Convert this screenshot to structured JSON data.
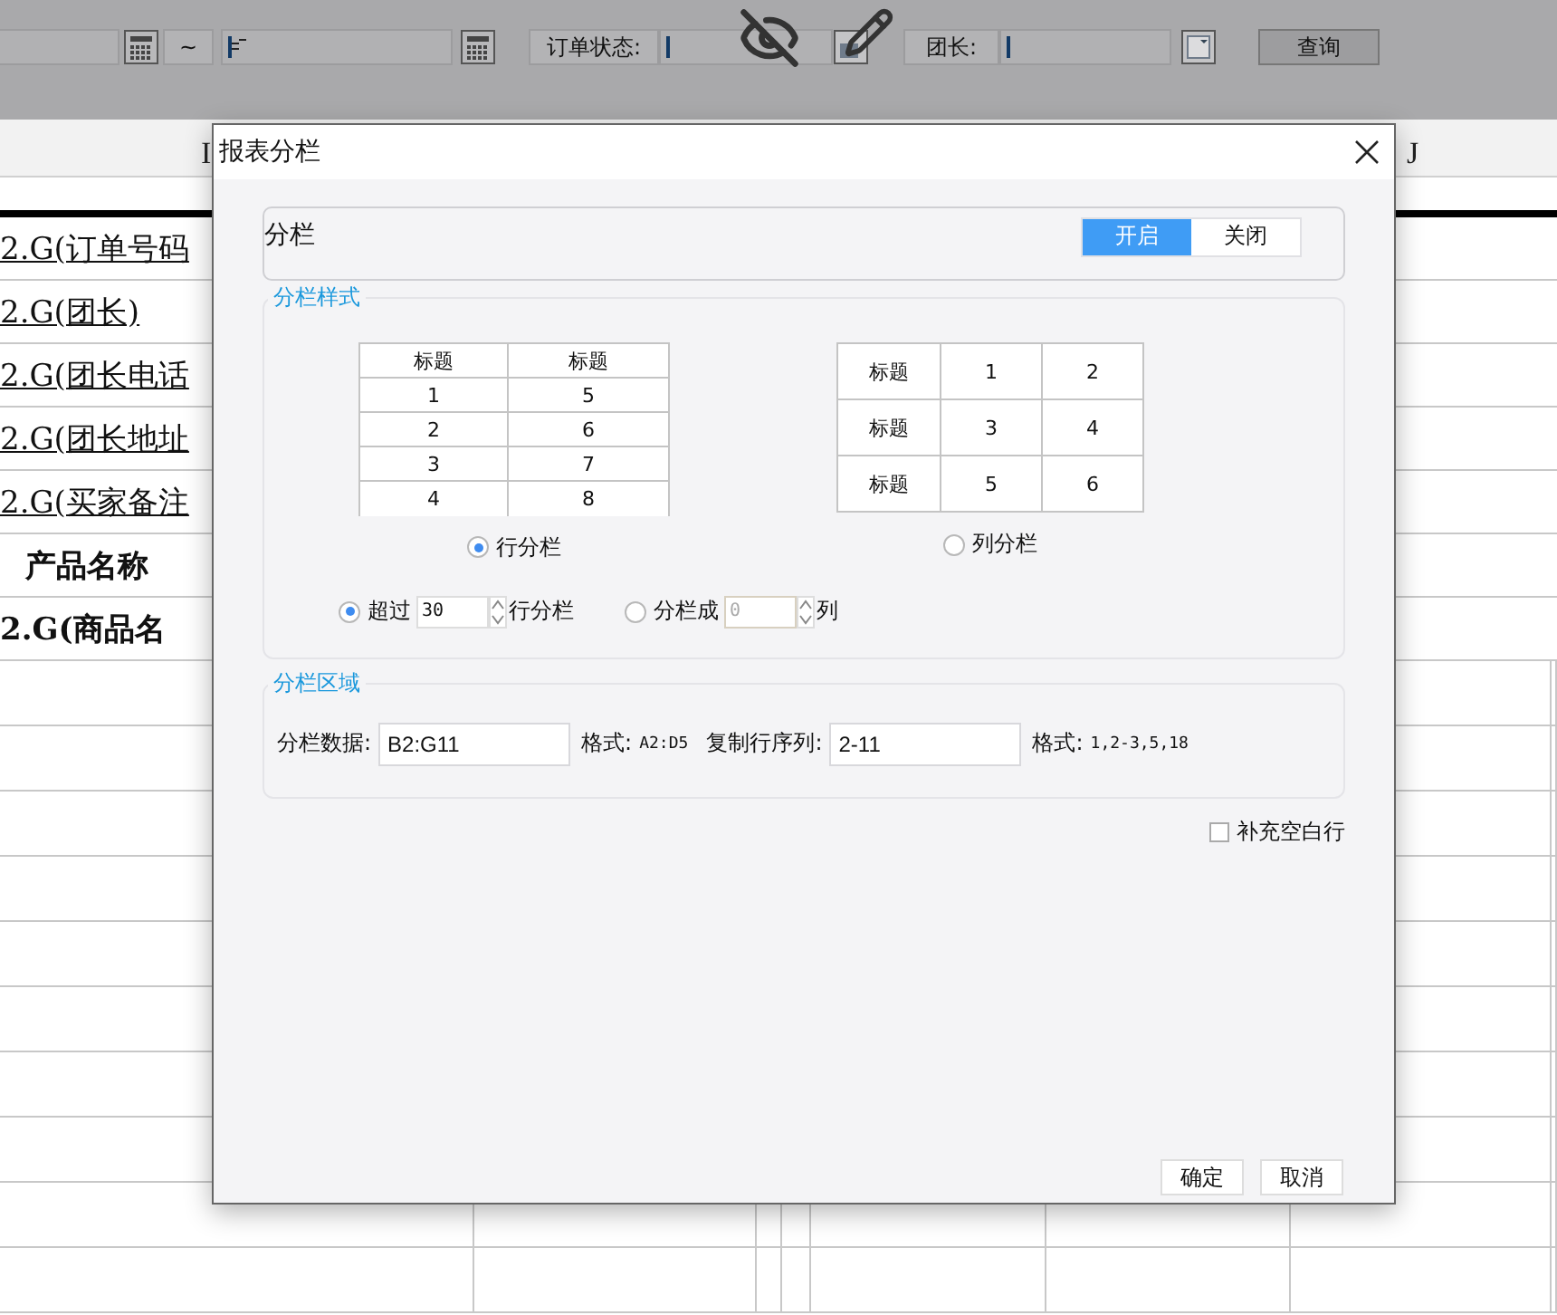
{
  "toolbar": {
    "range_separator": "~",
    "status_label": "订单状态:",
    "leader_label": "团长:",
    "query_button": "查询"
  },
  "sheet": {
    "column_headers": [
      "I",
      "J"
    ],
    "cells": [
      {
        "text": "2.G(订单号码",
        "kind": "field"
      },
      {
        "text": "2.G(团长)",
        "kind": "field"
      },
      {
        "text": "2.G(团长电话",
        "kind": "field"
      },
      {
        "text": "2.G(团长地址",
        "kind": "field"
      },
      {
        "text": "2.G(买家备注",
        "kind": "field"
      },
      {
        "text": "产品名称",
        "kind": "header"
      },
      {
        "text": "2.G(商品名",
        "kind": "detail"
      }
    ]
  },
  "dialog": {
    "title": "报表分栏",
    "switch": {
      "label": "分栏",
      "options": [
        {
          "label": "开启",
          "selected": true
        },
        {
          "label": "关闭",
          "selected": false
        }
      ]
    },
    "style_section": {
      "legend": "分栏样式",
      "row_preview": [
        [
          "标题",
          "标题"
        ],
        [
          "1",
          "5"
        ],
        [
          "2",
          "6"
        ],
        [
          "3",
          "7"
        ],
        [
          "4",
          "8"
        ]
      ],
      "column_preview": [
        [
          "标题",
          "1",
          "2"
        ],
        [
          "标题",
          "3",
          "4"
        ],
        [
          "标题",
          "5",
          "6"
        ]
      ],
      "modes": [
        {
          "label": "行分栏",
          "selected": true
        },
        {
          "label": "列分栏",
          "selected": false
        }
      ],
      "limits": [
        {
          "label": "超过",
          "value": "30",
          "suffix": "行分栏",
          "selected": true,
          "disabled": false
        },
        {
          "label": "分栏成",
          "value": "0",
          "suffix": "列",
          "selected": false,
          "disabled": true
        }
      ]
    },
    "region_section": {
      "legend": "分栏区域",
      "fields": [
        {
          "label": "分栏数据:",
          "value": "B2:G11",
          "hint_label": "格式:",
          "hint": "A2:D5"
        },
        {
          "label": "复制行序列:",
          "value": "2-11",
          "hint_label": "格式:",
          "hint": "1,2-3,5,18"
        }
      ]
    },
    "fill_blank": {
      "label": "补充空白行",
      "checked": false
    },
    "buttons": [
      "确定",
      "取消"
    ]
  }
}
